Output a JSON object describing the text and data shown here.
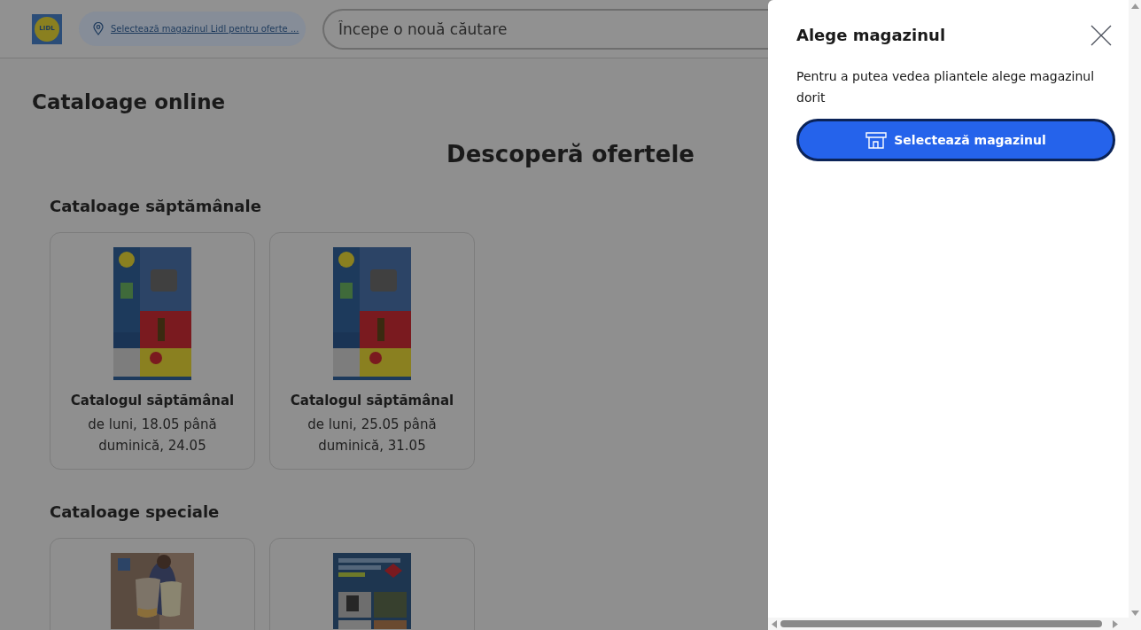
{
  "header": {
    "logo": "LIDL",
    "store_link": "Selectează magazinul Lidl pentru oferte ...",
    "search": {
      "placeholder": "Începe o nouă căutare"
    }
  },
  "page_title": "Cataloage online",
  "headline": "Descoperă ofertele",
  "sections": [
    {
      "title": "Cataloage săptămânale",
      "cards": [
        {
          "kind": "weekly",
          "title": "Catalogul săptămânal",
          "dates": "de luni, 18.05 până duminică, 24.05"
        },
        {
          "kind": "weekly",
          "title": "Catalogul săptămânal",
          "dates": "de luni, 25.05 până duminică, 31.05"
        }
      ]
    },
    {
      "title": "Cataloage speciale",
      "cards": [
        {
          "kind": "wine"
        },
        {
          "kind": "home"
        }
      ]
    }
  ],
  "drawer": {
    "title": "Alege magazinul",
    "text": "Pentru a putea vedea pliantele alege magazinul dorit",
    "button": "Selectează magazinul"
  }
}
